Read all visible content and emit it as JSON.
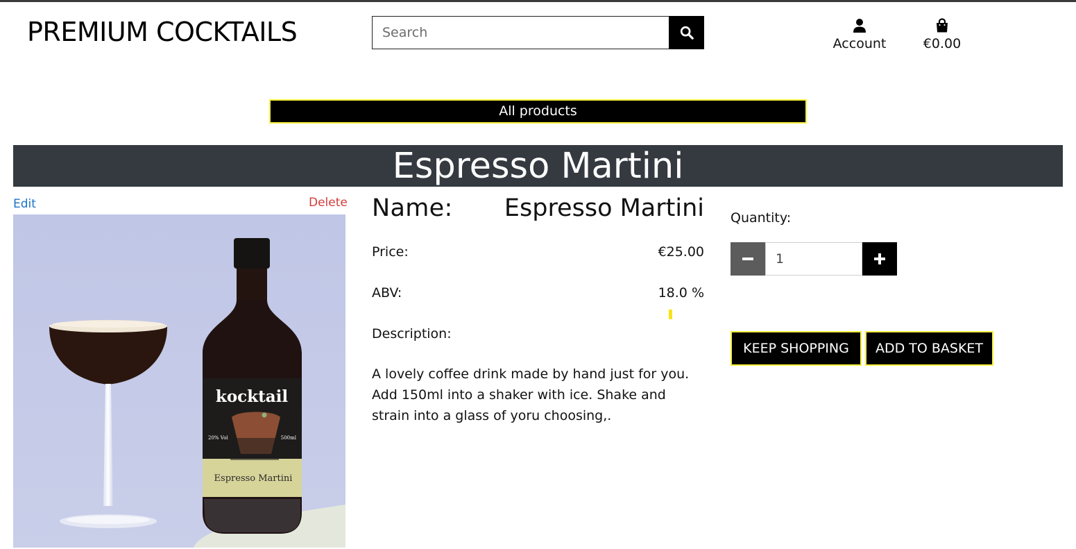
{
  "header": {
    "brand": "PREMIUM COCKTAILS",
    "search_placeholder": "Search",
    "account_label": "Account",
    "basket_total": "€0.00"
  },
  "nav": {
    "all_products_label": "All products"
  },
  "product": {
    "title": "Espresso Martini",
    "admin": {
      "edit_label": "Edit",
      "delete_label": "Delete"
    },
    "name_label": "Name:",
    "name_value": "Espresso Martini",
    "price_label": "Price:",
    "price_value": "€25.00",
    "abv_label": "ABV:",
    "abv_value": "18.0 %",
    "description_label": "Description:",
    "description_text": "A lovely coffee drink made by hand just for you. Add 150ml into a shaker with ice. Shake and strain into a glass of yoru choosing,.",
    "image": {
      "brand_text": "kocktail",
      "abv_text": "20% Vol",
      "volume_text": "500ml",
      "label_text": "Espresso Martini"
    }
  },
  "purchase": {
    "quantity_label": "Quantity:",
    "quantity_value": "1",
    "keep_shopping_label": "KEEP SHOPPING",
    "add_to_basket_label": "ADD TO BASKET"
  },
  "icons": {
    "search": "search-icon",
    "account": "user-icon",
    "basket": "shopping-bag-icon",
    "minus": "minus-icon",
    "plus": "plus-icon"
  },
  "colors": {
    "title_bar": "#343a40",
    "accent_border": "#f7ef3a",
    "edit_link": "#1a73c9",
    "delete_link": "#d43c3c",
    "image_bg": "#c3c9e8"
  }
}
